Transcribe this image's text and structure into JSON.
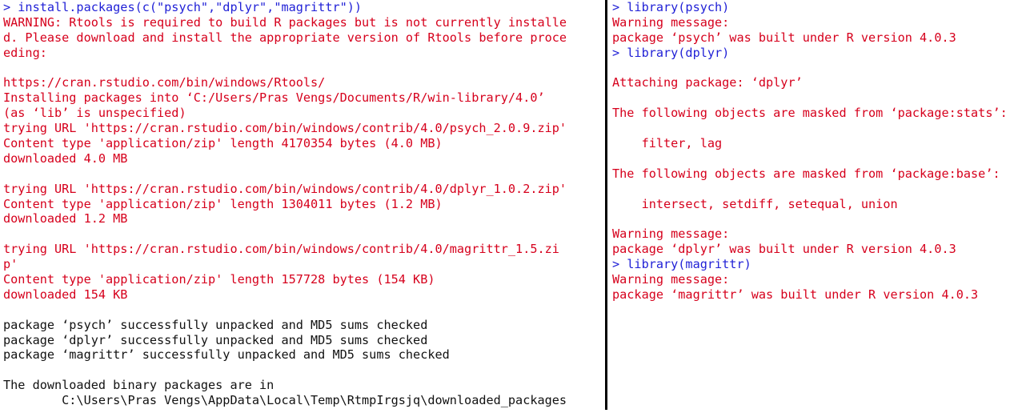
{
  "colors": {
    "command": "#1f1fd6",
    "warning": "#d6001c",
    "output": "#111111"
  },
  "left_console": [
    {
      "text": "> install.packages(c(\"psych\",\"dplyr\",\"magrittr\"))",
      "kind": "command"
    },
    {
      "text": "WARNING: Rtools is required to build R packages but is not currently installe",
      "kind": "warning"
    },
    {
      "text": "d. Please download and install the appropriate version of Rtools before proce",
      "kind": "warning"
    },
    {
      "text": "eding:",
      "kind": "warning"
    },
    {
      "text": "",
      "kind": "warning"
    },
    {
      "text": "https://cran.rstudio.com/bin/windows/Rtools/",
      "kind": "warning"
    },
    {
      "text": "Installing packages into ‘C:/Users/Pras Vengs/Documents/R/win-library/4.0’",
      "kind": "warning"
    },
    {
      "text": "(as ‘lib’ is unspecified)",
      "kind": "warning"
    },
    {
      "text": "trying URL 'https://cran.rstudio.com/bin/windows/contrib/4.0/psych_2.0.9.zip'",
      "kind": "warning"
    },
    {
      "text": "Content type 'application/zip' length 4170354 bytes (4.0 MB)",
      "kind": "warning"
    },
    {
      "text": "downloaded 4.0 MB",
      "kind": "warning"
    },
    {
      "text": "",
      "kind": "warning"
    },
    {
      "text": "trying URL 'https://cran.rstudio.com/bin/windows/contrib/4.0/dplyr_1.0.2.zip'",
      "kind": "warning"
    },
    {
      "text": "Content type 'application/zip' length 1304011 bytes (1.2 MB)",
      "kind": "warning"
    },
    {
      "text": "downloaded 1.2 MB",
      "kind": "warning"
    },
    {
      "text": "",
      "kind": "warning"
    },
    {
      "text": "trying URL 'https://cran.rstudio.com/bin/windows/contrib/4.0/magrittr_1.5.zi",
      "kind": "warning"
    },
    {
      "text": "p'",
      "kind": "warning"
    },
    {
      "text": "Content type 'application/zip' length 157728 bytes (154 KB)",
      "kind": "warning"
    },
    {
      "text": "downloaded 154 KB",
      "kind": "warning"
    },
    {
      "text": "",
      "kind": "output"
    },
    {
      "text": "package ‘psych’ successfully unpacked and MD5 sums checked",
      "kind": "output"
    },
    {
      "text": "package ‘dplyr’ successfully unpacked and MD5 sums checked",
      "kind": "output"
    },
    {
      "text": "package ‘magrittr’ successfully unpacked and MD5 sums checked",
      "kind": "output"
    },
    {
      "text": "",
      "kind": "output"
    },
    {
      "text": "The downloaded binary packages are in",
      "kind": "output"
    },
    {
      "text": "        C:\\Users\\Pras Vengs\\AppData\\Local\\Temp\\RtmpIrgsjq\\downloaded_packages",
      "kind": "output"
    }
  ],
  "right_console": [
    {
      "text": "> library(psych)",
      "kind": "command"
    },
    {
      "text": "Warning message:",
      "kind": "warning"
    },
    {
      "text": "package ‘psych’ was built under R version 4.0.3",
      "kind": "warning"
    },
    {
      "text": "> library(dplyr)",
      "kind": "command"
    },
    {
      "text": "",
      "kind": "warning"
    },
    {
      "text": "Attaching package: ‘dplyr’",
      "kind": "warning"
    },
    {
      "text": "",
      "kind": "warning"
    },
    {
      "text": "The following objects are masked from ‘package:stats’:",
      "kind": "warning"
    },
    {
      "text": "",
      "kind": "warning"
    },
    {
      "text": "    filter, lag",
      "kind": "warning"
    },
    {
      "text": "",
      "kind": "warning"
    },
    {
      "text": "The following objects are masked from ‘package:base’:",
      "kind": "warning"
    },
    {
      "text": "",
      "kind": "warning"
    },
    {
      "text": "    intersect, setdiff, setequal, union",
      "kind": "warning"
    },
    {
      "text": "",
      "kind": "warning"
    },
    {
      "text": "Warning message:",
      "kind": "warning"
    },
    {
      "text": "package ‘dplyr’ was built under R version 4.0.3",
      "kind": "warning"
    },
    {
      "text": "> library(magrittr)",
      "kind": "command"
    },
    {
      "text": "Warning message:",
      "kind": "warning"
    },
    {
      "text": "package ‘magrittr’ was built under R version 4.0.3",
      "kind": "warning"
    }
  ]
}
